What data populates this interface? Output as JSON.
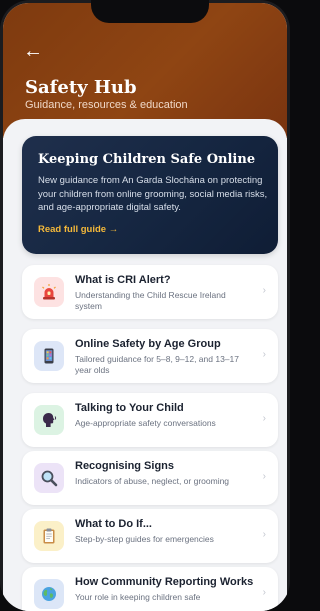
{
  "header": {
    "back_icon": "←",
    "title": "Safety Hub",
    "subtitle": "Guidance, resources & education"
  },
  "feature": {
    "title": "Keeping Children Safe Online",
    "body": "New guidance from An Garda Slochána on protecting your children from online grooming, social media risks, and age-appropriate digital safety.",
    "link": "Read full guide →"
  },
  "cards": [
    {
      "title": "What is CRI Alert?",
      "desc": "Understanding the Child Rescue Ireland system",
      "icon": "alarm-siren-icon",
      "color": "#fde2e2"
    },
    {
      "title": "Online Safety by Age Group",
      "desc": "Tailored guidance for 5–8, 9–12, and 13–17 year olds",
      "icon": "phone-icon",
      "color": "#dde6f7"
    },
    {
      "title": "Talking to Your Child",
      "desc": "Age-appropriate safety conversations",
      "icon": "speaking-head-icon",
      "color": "#dcf3e3"
    },
    {
      "title": "Recognising Signs",
      "desc": "Indicators of abuse, neglect, or grooming",
      "icon": "magnifier-icon",
      "color": "#ece3f7"
    },
    {
      "title": "What to Do If...",
      "desc": "Step-by-step guides for emergencies",
      "icon": "clipboard-icon",
      "color": "#fbf0c8"
    },
    {
      "title": "How Community Reporting Works",
      "desc": "Your role in keeping children safe",
      "icon": "globe-icon",
      "color": "#dce6f7"
    }
  ],
  "chevron": "›"
}
